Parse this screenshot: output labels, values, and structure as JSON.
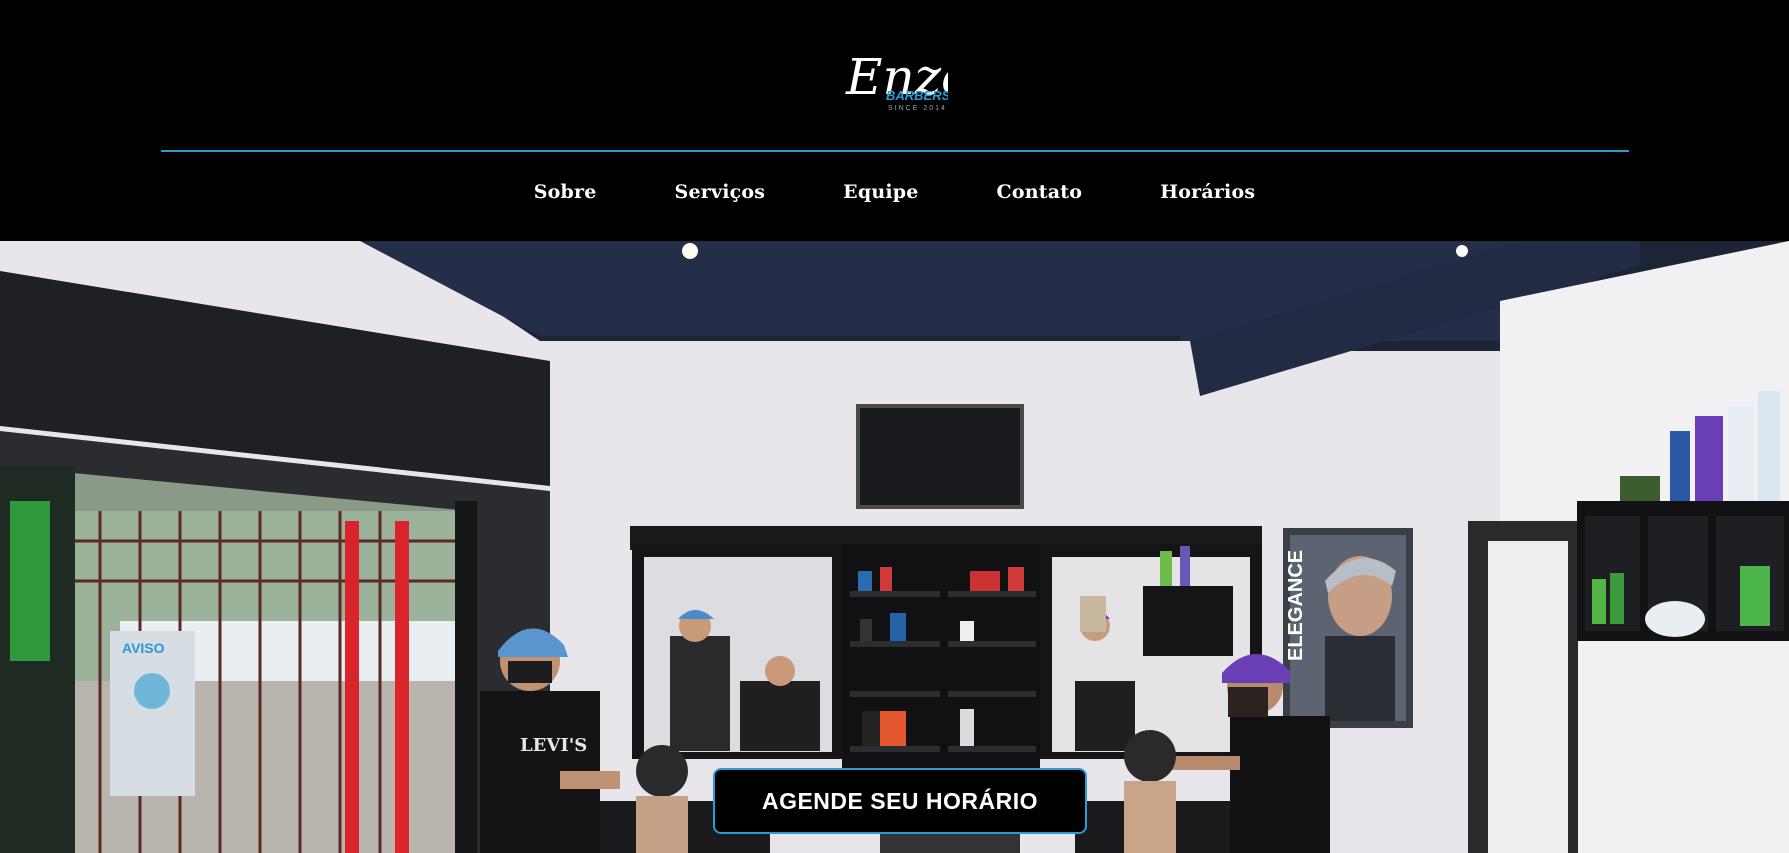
{
  "brand": {
    "logo_script": "Enzo",
    "logo_sub": "BARBERSHOP",
    "logo_since": "SINCE 2014",
    "accent": "#2b9bd4"
  },
  "nav": {
    "items": [
      {
        "label": "Sobre"
      },
      {
        "label": "Serviços"
      },
      {
        "label": "Equipe"
      },
      {
        "label": "Contato"
      },
      {
        "label": "Horários"
      }
    ]
  },
  "hero": {
    "image": "barbershop-interior-photo",
    "cta_label": "AGENDE SEU HORÁRIO",
    "poster_text": "ELEGANCE",
    "notice_text": "AVISO",
    "shirt_text": "LEVI'S"
  }
}
